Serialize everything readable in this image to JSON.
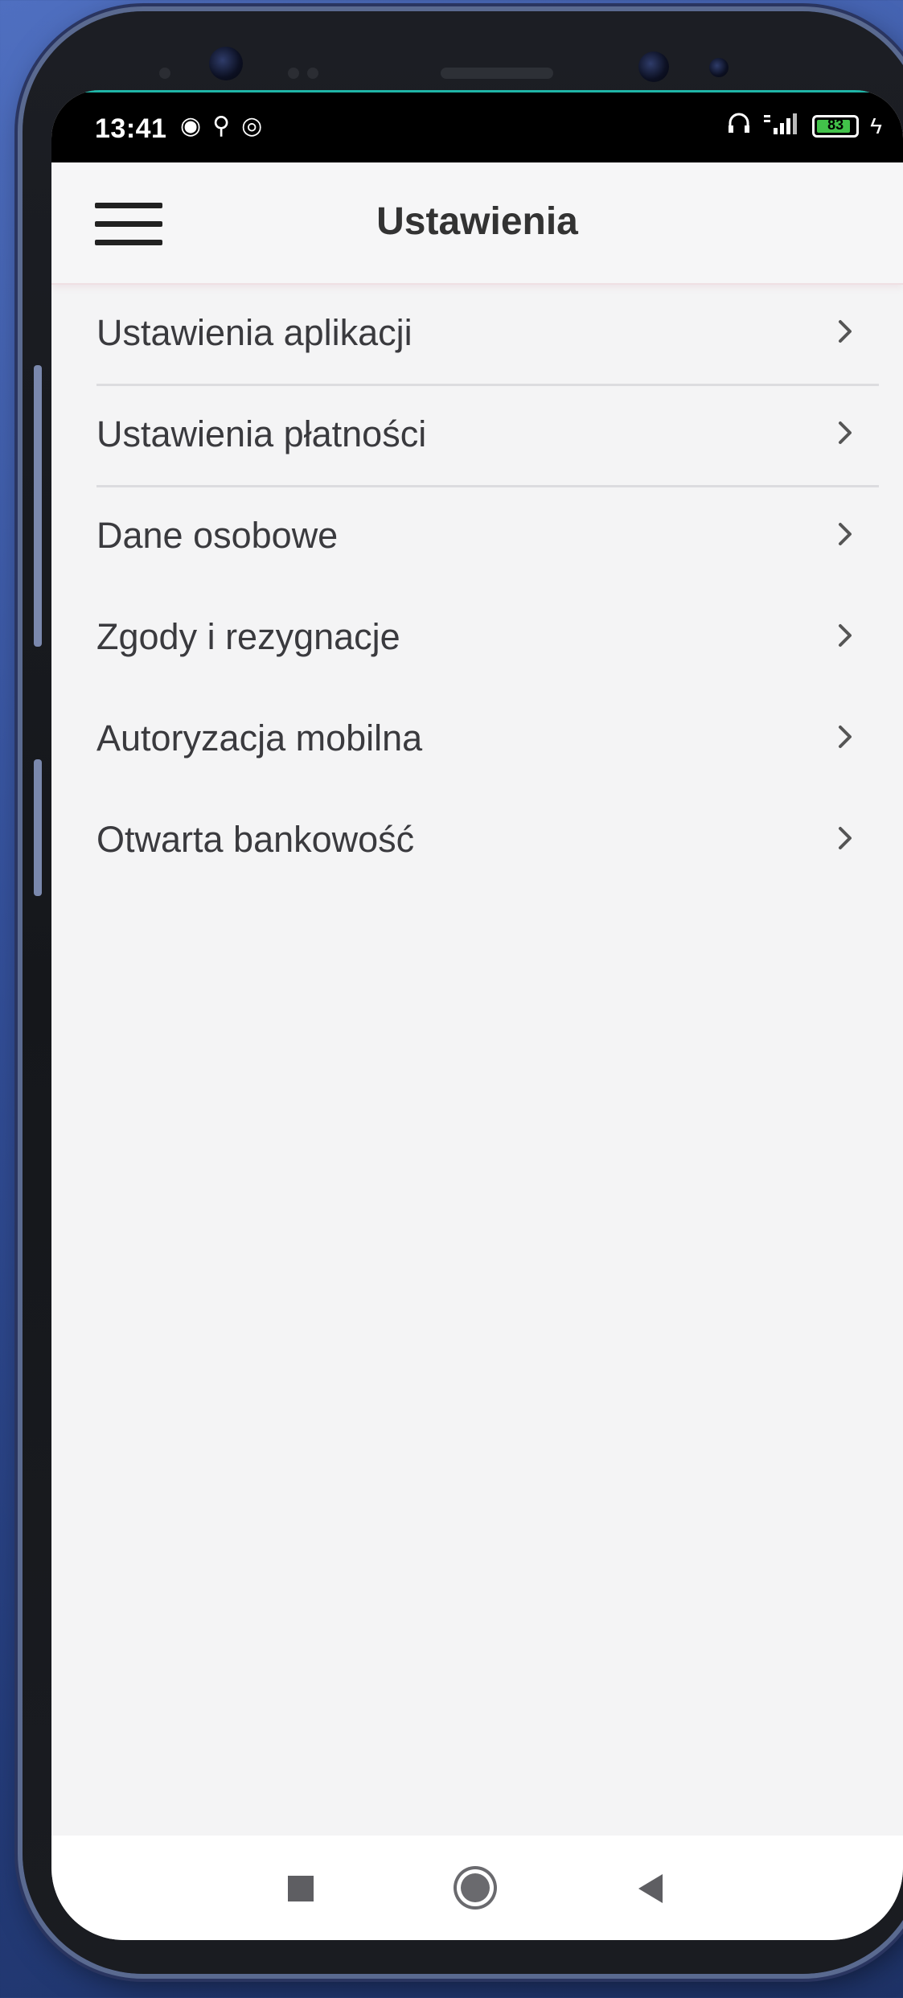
{
  "status_bar": {
    "time": "13:41",
    "battery_level": "83",
    "left_icons": [
      "message-icon",
      "location-icon",
      "sync-icon"
    ],
    "right_icons": [
      "headphones-icon",
      "signal-icon",
      "battery-icon"
    ]
  },
  "app_bar": {
    "title": "Ustawienia",
    "menu_icon": "hamburger-icon"
  },
  "menu": {
    "items": [
      {
        "label": "Ustawienia aplikacji"
      },
      {
        "label": "Ustawienia płatności"
      },
      {
        "label": "Dane osobowe"
      },
      {
        "label": "Zgody i rezygnacje"
      },
      {
        "label": "Autoryzacja mobilna"
      },
      {
        "label": "Otwarta bankowość"
      }
    ]
  },
  "nav_bar": {
    "buttons": [
      "recents-icon",
      "home-icon",
      "back-icon"
    ]
  },
  "colors": {
    "background": "#34509a",
    "screen": "#f4f4f5",
    "text": "#3a3a3e",
    "battery": "#42c24a",
    "status_accent": "#1fb6a8"
  }
}
